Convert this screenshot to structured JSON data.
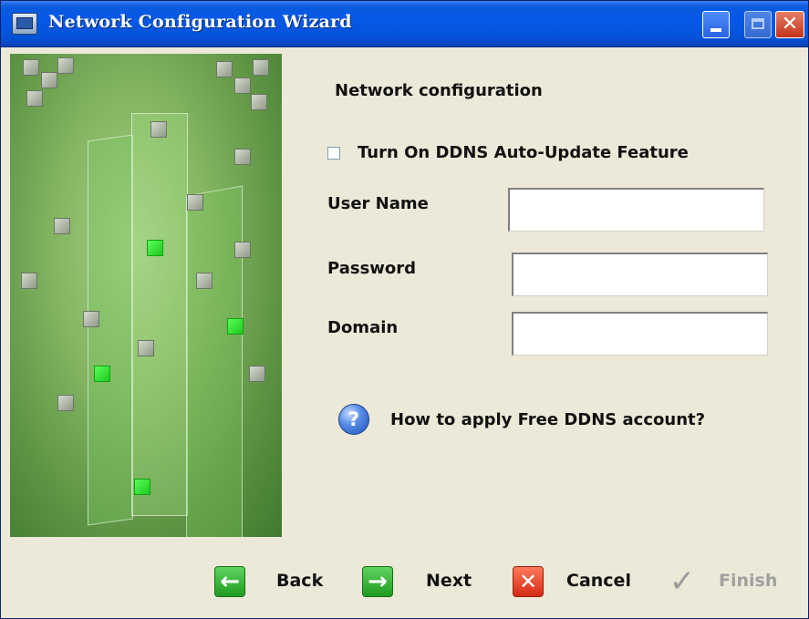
{
  "window": {
    "title": "Network Configuration Wizard",
    "icons": {
      "app": "monitor-icon",
      "minimize": "minimize-icon",
      "maximize": "maximize-icon",
      "close": "close-icon"
    }
  },
  "main": {
    "section_title": "Network configuration",
    "ddns_checkbox": {
      "label": "Turn On DDNS Auto-Update Feature",
      "checked": false
    },
    "fields": {
      "user_name": {
        "label": "User Name",
        "value": ""
      },
      "password": {
        "label": "Password",
        "value": ""
      },
      "domain": {
        "label": "Domain",
        "value": ""
      }
    },
    "help": {
      "icon": "question-icon",
      "text": "How to apply Free DDNS account?"
    }
  },
  "footer": {
    "back": {
      "label": "Back",
      "icon": "arrow-left-icon"
    },
    "next": {
      "label": "Next",
      "icon": "arrow-right-icon"
    },
    "cancel": {
      "label": "Cancel",
      "icon": "x-icon"
    },
    "finish": {
      "label": "Finish",
      "icon": "checkmark-icon",
      "disabled": true
    }
  },
  "colors": {
    "titlebar": "#0558e8",
    "dialog_bg": "#ece9d8",
    "side_panel_green": "#86b764",
    "back_next_green": "#1f9b1f",
    "cancel_red": "#d32a12",
    "disabled_gray": "#a0a0a0"
  }
}
